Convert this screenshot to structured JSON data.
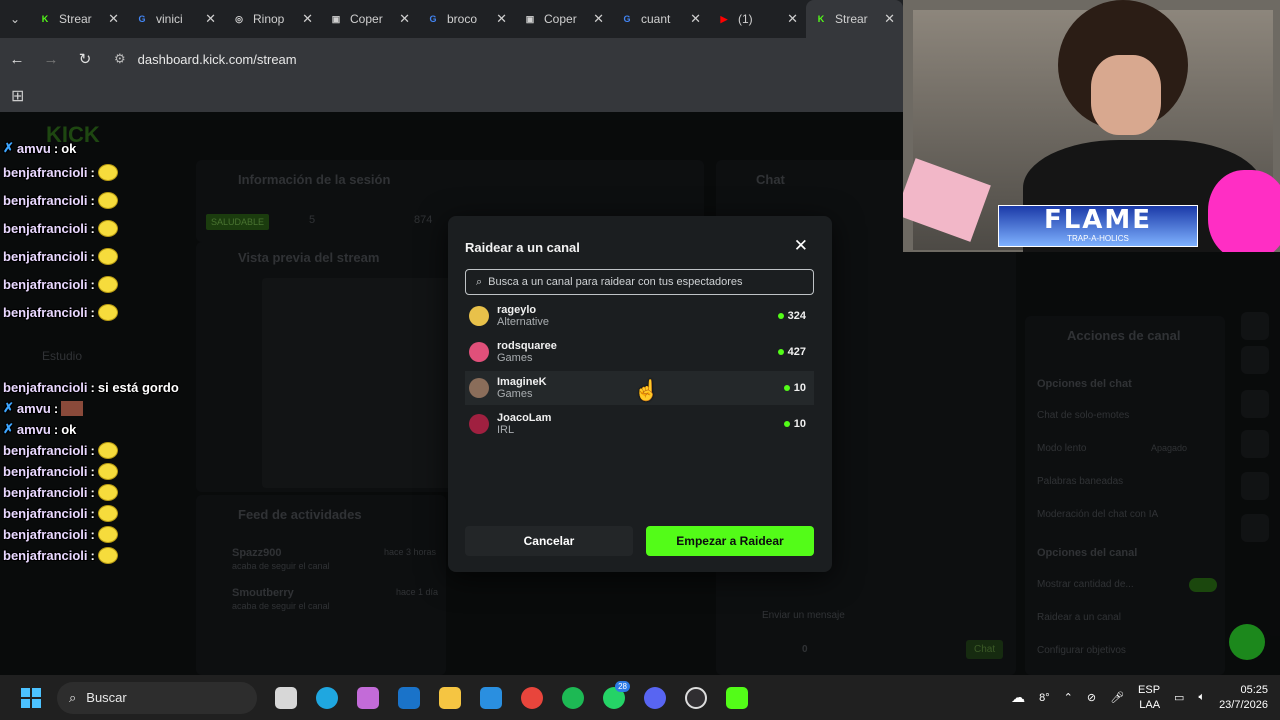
{
  "browser": {
    "tabs": [
      {
        "label": "Strear",
        "fav": "K",
        "color": "#53fc18"
      },
      {
        "label": "vinici",
        "fav": "G",
        "color": "#4285f4"
      },
      {
        "label": "Rinop",
        "fav": "◎",
        "color": "#d0d0d0"
      },
      {
        "label": "Coper",
        "fav": "▣",
        "color": "#d0d0d0"
      },
      {
        "label": "broco",
        "fav": "G",
        "color": "#4285f4"
      },
      {
        "label": "Coper",
        "fav": "▣",
        "color": "#d0d0d0"
      },
      {
        "label": "cuant",
        "fav": "G",
        "color": "#4285f4"
      },
      {
        "label": "(1)",
        "fav": "▶",
        "color": "#ff0000"
      },
      {
        "label": "Strear",
        "fav": "K",
        "color": "#53fc18"
      }
    ],
    "url": "dashboard.kick.com/stream"
  },
  "dashboard": {
    "session_info": "Información de la sesión",
    "preview": "Vista previa del stream",
    "activity": "Feed de actividades",
    "chat": "Chat",
    "channel_actions": "Acciones de canal",
    "chat_options": "Opciones del chat",
    "emote_only": "Chat de solo-emotes",
    "slow_mode": "Modo lento",
    "slow_value": "Apagado",
    "banned_words": "Palabras baneadas",
    "ai_mod": "Moderación del chat con IA",
    "channel_options": "Opciones del canal",
    "show_count": "Mostrar cantidad de...",
    "raid_channel": "Raidear a un canal",
    "config_goals": "Configurar objetivos",
    "status": "SALUDABLE",
    "stat1": "5",
    "stat2": "874",
    "feed1_user": "Spazz900",
    "feed1_text": "acaba de seguir el canal",
    "feed1_time": "hace 3 horas",
    "feed2_user": "Smoutberry",
    "feed2_text": "acaba de seguir el canal",
    "feed2_time": "hace 1 día",
    "studio": "Estudio",
    "chat_placeholder": "Enviar un mensaje",
    "chat_btn": "Chat",
    "viewers_count": "0"
  },
  "modal": {
    "title": "Raidear a un canal",
    "search_placeholder": "Busca a un canal para raidear con tus espectadores",
    "channels": [
      {
        "name": "rageylo",
        "category": "Alternative",
        "viewers": "324",
        "color": "#e8c14a"
      },
      {
        "name": "rodsquaree",
        "category": "Games",
        "viewers": "427",
        "color": "#e0507a"
      },
      {
        "name": "ImagineK",
        "category": "Games",
        "viewers": "10",
        "color": "#8a6d5a"
      },
      {
        "name": "JoacoLam",
        "category": "IRL",
        "viewers": "10",
        "color": "#a02040"
      }
    ],
    "cancel": "Cancelar",
    "start": "Empezar a Raidear"
  },
  "overlay_chat": [
    {
      "user": "amvu",
      "msg": "ok",
      "badge": true,
      "emote": false
    },
    {
      "user": "benjafrancioli",
      "msg": "",
      "badge": false,
      "emote": true
    },
    {
      "user": "benjafrancioli",
      "msg": "",
      "badge": false,
      "emote": true
    },
    {
      "user": "benjafrancioli",
      "msg": "",
      "badge": false,
      "emote": true
    },
    {
      "user": "benjafrancioli",
      "msg": "",
      "badge": false,
      "emote": true
    },
    {
      "user": "benjafrancioli",
      "msg": "",
      "badge": false,
      "emote": true
    },
    {
      "user": "benjafrancioli",
      "msg": "",
      "badge": false,
      "emote": true
    },
    {
      "user": "benjafrancioli",
      "msg": "si está gordo",
      "badge": false,
      "emote": false
    },
    {
      "user": "amvu",
      "msg": "",
      "badge": true,
      "emote": false,
      "picture": true
    },
    {
      "user": "amvu",
      "msg": "ok",
      "badge": true,
      "emote": false
    },
    {
      "user": "benjafrancioli",
      "msg": "",
      "badge": false,
      "emote": true
    },
    {
      "user": "benjafrancioli",
      "msg": "",
      "badge": false,
      "emote": true
    },
    {
      "user": "benjafrancioli",
      "msg": "",
      "badge": false,
      "emote": true
    },
    {
      "user": "benjafrancioli",
      "msg": "",
      "badge": false,
      "emote": true
    },
    {
      "user": "benjafrancioli",
      "msg": "",
      "badge": false,
      "emote": true
    },
    {
      "user": "benjafrancioli",
      "msg": "",
      "badge": false,
      "emote": true
    }
  ],
  "webcam": {
    "banner": "FLAME",
    "sub": "TRAP-A-HOLICS"
  },
  "taskbar": {
    "search": "Buscar",
    "temp": "8°",
    "lang1": "ESP",
    "lang2": "LAA",
    "time": "05:25",
    "date": "23/7/2026",
    "badge": "28"
  }
}
